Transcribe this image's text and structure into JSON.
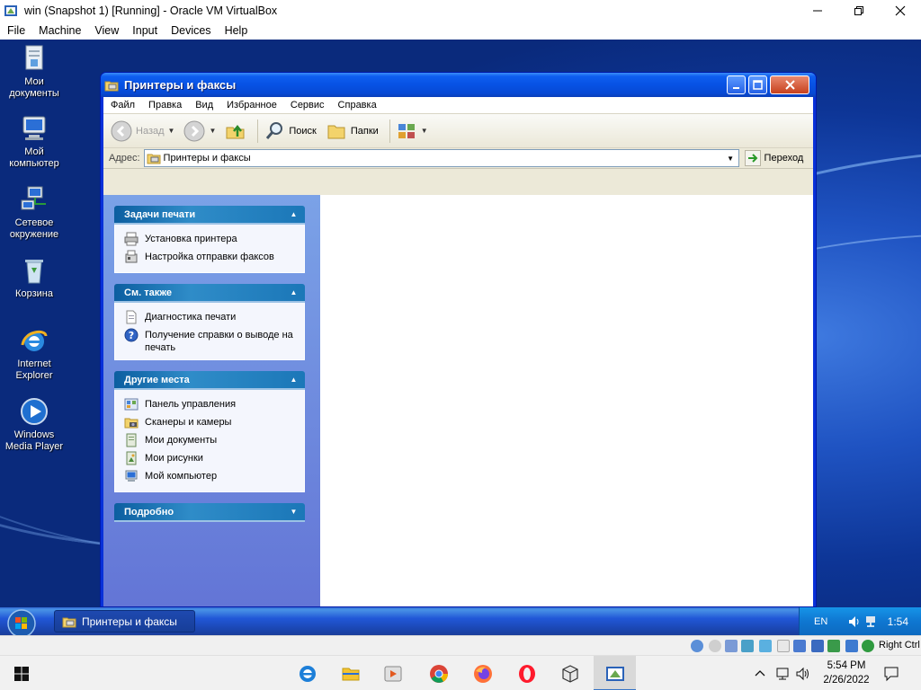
{
  "vbox": {
    "title": "win (Snapshot 1) [Running] - Oracle VM VirtualBox",
    "menu": [
      "File",
      "Machine",
      "View",
      "Input",
      "Devices",
      "Help"
    ],
    "status_right": "Right Ctrl"
  },
  "desktop": {
    "icons": [
      {
        "label": "Мои документы",
        "icon": "my-documents-icon"
      },
      {
        "label": "Мой компьютер",
        "icon": "my-computer-icon"
      },
      {
        "label": "Сетевое окружение",
        "icon": "network-icon"
      },
      {
        "label": "Корзина",
        "icon": "recycle-bin-icon"
      },
      {
        "label": "Internet Explorer",
        "icon": "ie-icon"
      },
      {
        "label": "Windows Media Player",
        "icon": "media-player-icon"
      }
    ]
  },
  "window": {
    "title": "Принтеры и факсы",
    "menu": [
      "Файл",
      "Правка",
      "Вид",
      "Избранное",
      "Сервис",
      "Справка"
    ],
    "toolbar": {
      "back": "Назад",
      "search": "Поиск",
      "folders": "Папки"
    },
    "address": {
      "label": "Адрес:",
      "value": "Принтеры и факсы",
      "go": "Переход"
    },
    "panels": [
      {
        "title": "Задачи печати",
        "special": true,
        "items": [
          {
            "label": "Установка принтера",
            "icon": "printer-add-icon"
          },
          {
            "label": "Настройка отправки факсов",
            "icon": "fax-icon"
          }
        ]
      },
      {
        "title": "См. также",
        "special": true,
        "items": [
          {
            "label": "Диагностика печати",
            "icon": "document-icon"
          },
          {
            "label": "Получение справки о выводе на печать",
            "icon": "help-icon"
          }
        ]
      },
      {
        "title": "Другие места",
        "special": true,
        "items": [
          {
            "label": "Панель управления",
            "icon": "control-panel-icon"
          },
          {
            "label": "Сканеры и камеры",
            "icon": "scanner-icon"
          },
          {
            "label": "Мои документы",
            "icon": "folder-icon"
          },
          {
            "label": "Мои рисунки",
            "icon": "pictures-icon"
          },
          {
            "label": "Мой компьютер",
            "icon": "computer-icon"
          }
        ]
      },
      {
        "title": "Подробно",
        "special": true,
        "items": []
      }
    ]
  },
  "xp_taskbar": {
    "task_label": "Принтеры и факсы",
    "lang": "EN",
    "clock": "1:54"
  },
  "host_taskbar": {
    "time": "5:54 PM",
    "date": "2/26/2022"
  }
}
